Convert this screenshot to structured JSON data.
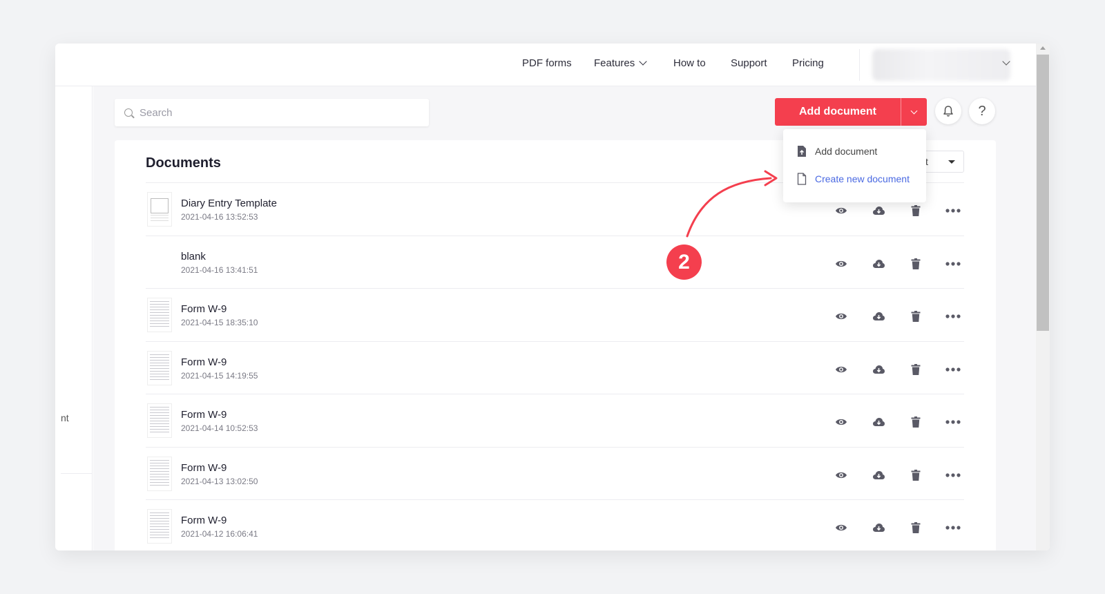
{
  "nav": {
    "links": [
      "PDF forms",
      "Features",
      "How to",
      "Support",
      "Pricing"
    ]
  },
  "sidebar": {
    "partial_text": "nt"
  },
  "search": {
    "placeholder": "Search",
    "value": ""
  },
  "toolbar": {
    "add_document_label": "Add document",
    "help_label": "?"
  },
  "dropdown": {
    "items": [
      "Add document",
      "Create new document"
    ]
  },
  "documents": {
    "title": "Documents",
    "sort_partial": "st",
    "rows": [
      {
        "name": "Diary Entry Template",
        "date": "2021-04-16 13:52:53",
        "thumb": "diary"
      },
      {
        "name": "blank",
        "date": "2021-04-16 13:41:51",
        "thumb": "blank"
      },
      {
        "name": "Form W-9",
        "date": "2021-04-15 18:35:10",
        "thumb": "form"
      },
      {
        "name": "Form W-9",
        "date": "2021-04-15 14:19:55",
        "thumb": "form"
      },
      {
        "name": "Form W-9",
        "date": "2021-04-14 10:52:53",
        "thumb": "form"
      },
      {
        "name": "Form W-9",
        "date": "2021-04-13 13:02:50",
        "thumb": "form"
      },
      {
        "name": "Form W-9",
        "date": "2021-04-12 16:06:41",
        "thumb": "form"
      }
    ]
  },
  "annotation": {
    "step": "2"
  },
  "colors": {
    "accent": "#f43f4e",
    "link": "#4a69e2",
    "icon": "#5a5a66"
  },
  "icons": {
    "row_actions": [
      "eye-icon",
      "cloud-download-icon",
      "trash-icon",
      "more-icon"
    ]
  }
}
